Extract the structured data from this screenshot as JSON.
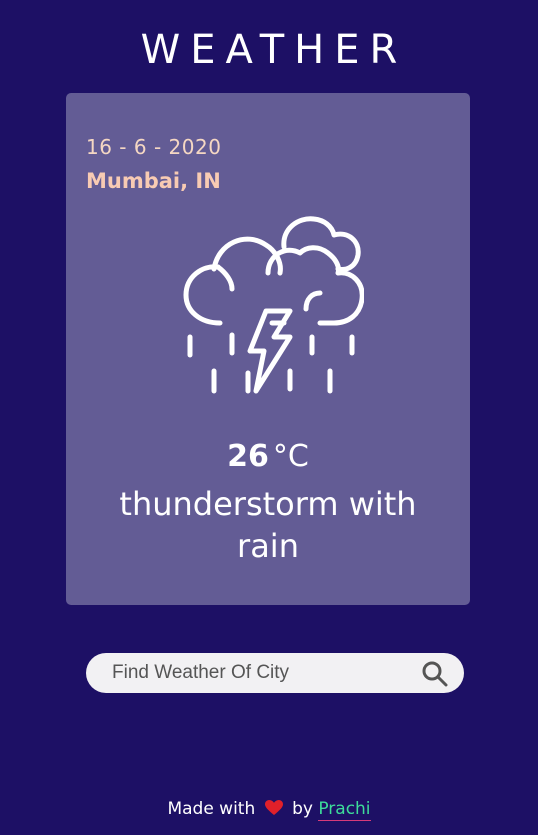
{
  "app": {
    "title": "WEATHER"
  },
  "card": {
    "date": "16 - 6 - 2020",
    "city": "Mumbai, IN",
    "temperature": "26",
    "unit": "°C",
    "description": "thunderstorm with rain",
    "icon": "thunderstorm-rain-icon"
  },
  "search": {
    "placeholder": "Find Weather Of City",
    "icon": "search-icon"
  },
  "footer": {
    "made_with": "Made with",
    "by": "by",
    "author": "Prachi",
    "icon": "heart-icon"
  },
  "colors": {
    "background": "#1d1065",
    "card": "#635c95",
    "date": "#f5d7c3",
    "city": "#f8cbb3",
    "author_link": "#3ddc9a",
    "heart": "#e0202a"
  }
}
